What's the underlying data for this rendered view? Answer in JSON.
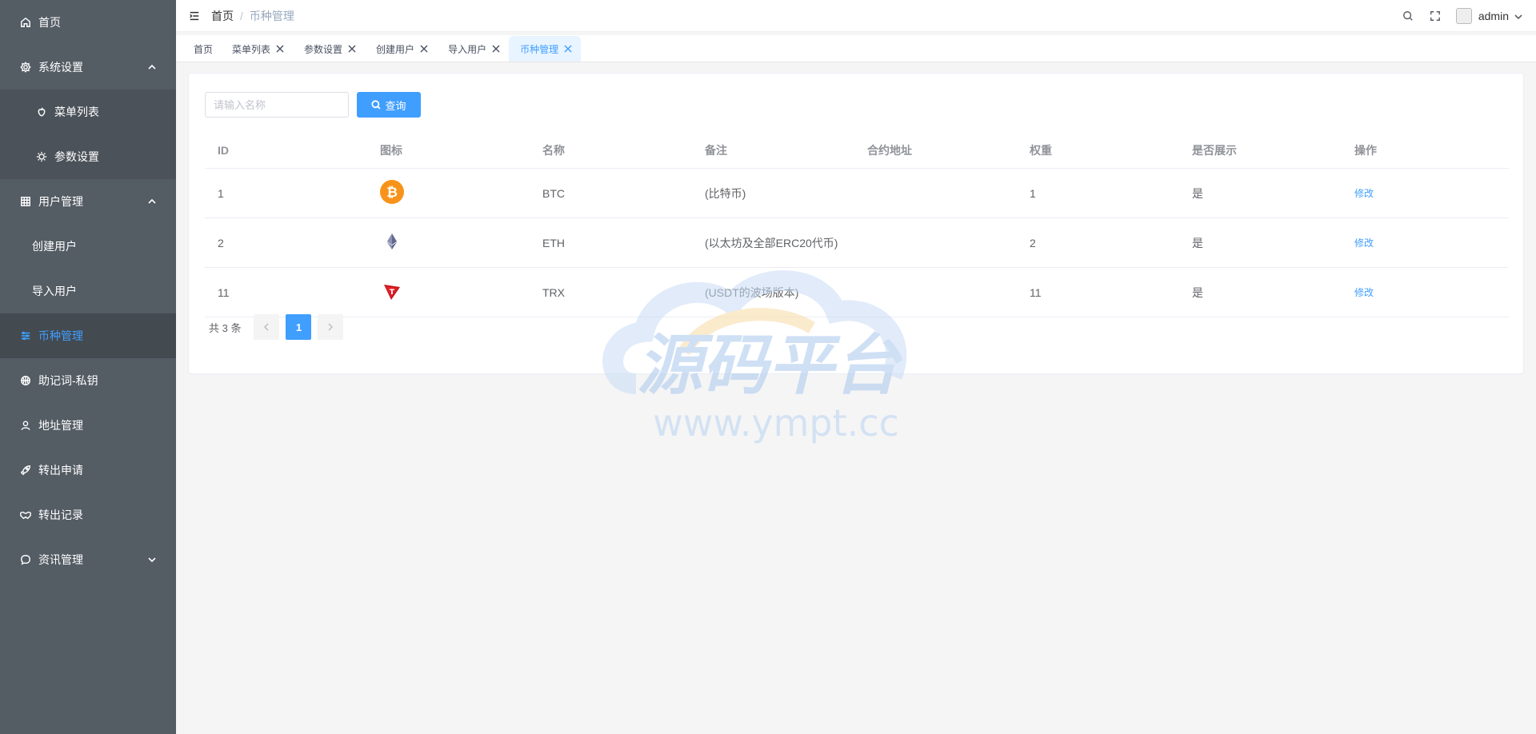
{
  "sidebar": {
    "items": [
      {
        "label": "首页"
      },
      {
        "label": "系统设置"
      },
      {
        "label": "菜单列表"
      },
      {
        "label": "参数设置"
      },
      {
        "label": "用户管理"
      },
      {
        "label": "创建用户"
      },
      {
        "label": "导入用户"
      },
      {
        "label": "币种管理"
      },
      {
        "label": "助记词-私钥"
      },
      {
        "label": "地址管理"
      },
      {
        "label": "转出申请"
      },
      {
        "label": "转出记录"
      },
      {
        "label": "资讯管理"
      }
    ],
    "active_color": "#409eff",
    "bg_color": "#545c64"
  },
  "header": {
    "breadcrumb_home": "首页",
    "breadcrumb_sep": "/",
    "breadcrumb_current": "币种管理",
    "user": "admin"
  },
  "tags": [
    {
      "label": "首页"
    },
    {
      "label": "菜单列表"
    },
    {
      "label": "参数设置"
    },
    {
      "label": "创建用户"
    },
    {
      "label": "导入用户"
    },
    {
      "label": "币种管理"
    }
  ],
  "search": {
    "placeholder": "请输入名称",
    "button_label": "查询"
  },
  "table": {
    "columns": [
      "ID",
      "图标",
      "名称",
      "备注",
      "合约地址",
      "权重",
      "是否展示",
      "操作"
    ],
    "rows": [
      {
        "id": "1",
        "icon": "bitcoin-icon",
        "name": "BTC",
        "remark": "(比特币)",
        "address": "",
        "weight": "1",
        "show": "是",
        "action": "修改"
      },
      {
        "id": "2",
        "icon": "ethereum-icon",
        "name": "ETH",
        "remark": "(以太坊及全部ERC20代币)",
        "address": "",
        "weight": "2",
        "show": "是",
        "action": "修改"
      },
      {
        "id": "11",
        "icon": "tron-icon",
        "name": "TRX",
        "remark": "(USDT的波场版本)",
        "address": "",
        "weight": "11",
        "show": "是",
        "action": "修改"
      }
    ]
  },
  "pagination": {
    "total_text": "共 3 条",
    "current_page": "1"
  },
  "watermark": {
    "title": "源码平台",
    "url": "www.ympt.cc"
  }
}
